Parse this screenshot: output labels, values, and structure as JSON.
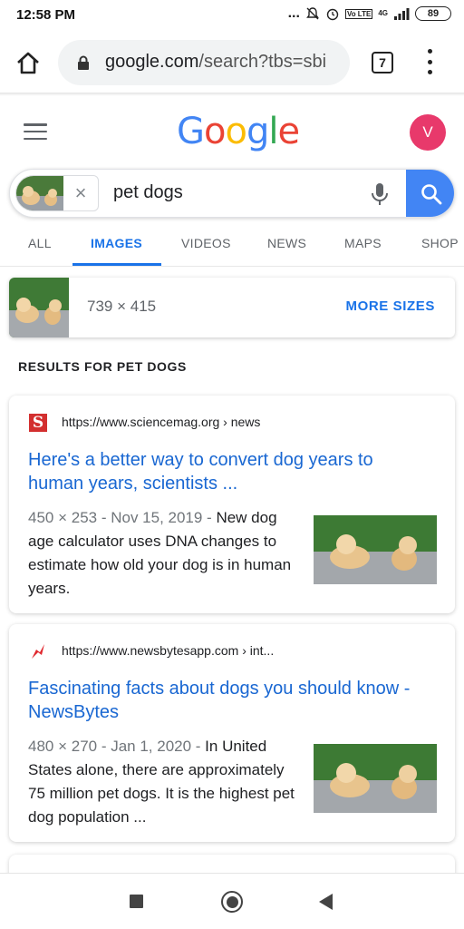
{
  "status_bar": {
    "time": "12:58 PM",
    "dots": "...",
    "network_type": "4G",
    "lte_label": "Vo LTE",
    "battery": "89"
  },
  "browser": {
    "url_host": "google.com",
    "url_path": "/search?tbs=sbi",
    "tab_count": "7"
  },
  "header": {
    "logo_letters": [
      "G",
      "o",
      "o",
      "g",
      "l",
      "e"
    ],
    "avatar_letter": "V"
  },
  "search": {
    "query": "pet dogs",
    "clear_symbol": "×"
  },
  "tabs": [
    {
      "label": "ALL",
      "active": false
    },
    {
      "label": "IMAGES",
      "active": true
    },
    {
      "label": "VIDEOS",
      "active": false
    },
    {
      "label": "NEWS",
      "active": false
    },
    {
      "label": "MAPS",
      "active": false
    },
    {
      "label": "SHOP",
      "active": false
    }
  ],
  "size_card": {
    "dimensions": "739 × 415",
    "more_sizes": "MORE SIZES"
  },
  "results_heading": "RESULTS FOR PET DOGS",
  "results": [
    {
      "favicon_letter": "S",
      "source": "https://www.sciencemag.org › news",
      "title": "Here's a better way to convert dog years to human years, scientists ...",
      "meta": "450 × 253 - Nov 15, 2019 - ",
      "snippet": "New dog age calculator uses DNA changes to estimate how old your dog is in human years."
    },
    {
      "favicon_letter": "",
      "source": "https://www.newsbytesapp.com › int...",
      "title": "Fascinating facts about dogs you should know - NewsBytes",
      "meta": "480 × 270 - Jan 1, 2020 - ",
      "snippet": "In United States alone, there are approximately 75 million pet dogs. It is the highest pet dog population ..."
    }
  ],
  "colors": {
    "accent": "#1a73e8",
    "avatar_bg": "#e8396b",
    "search_button": "#4285f4",
    "link": "#1967d2",
    "sciencemag_red": "#d32f2f",
    "newsbytes_red": "#e0282e"
  }
}
